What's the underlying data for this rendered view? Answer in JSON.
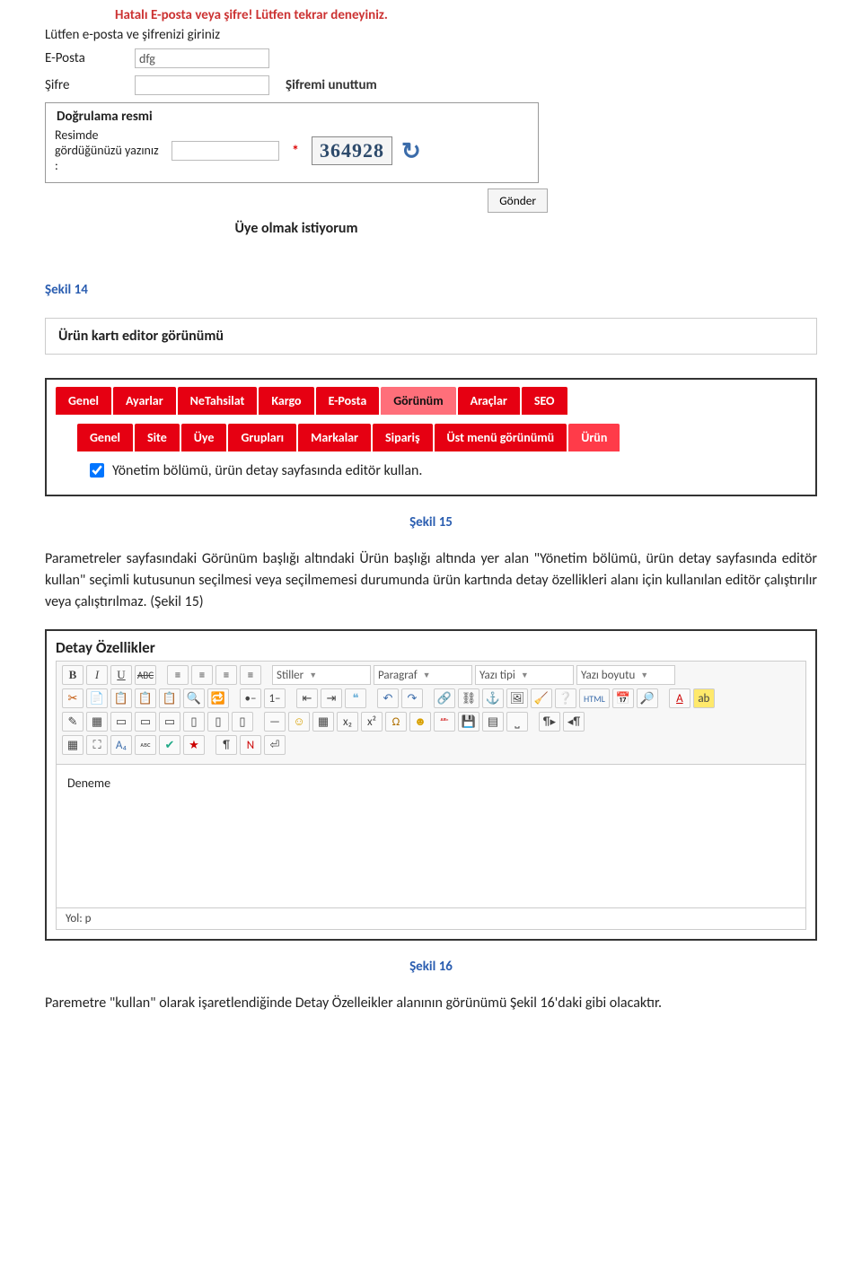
{
  "login": {
    "error": "Hatalı E-posta veya şifre! Lütfen tekrar deneyiniz.",
    "prompt": "Lütfen e-posta ve şifrenizi giriniz",
    "email_label": "E-Posta",
    "email_value": "dfg",
    "password_label": "Şifre",
    "forgot": "Şifremi unuttum",
    "captcha_legend": "Doğrulama resmi",
    "captcha_label": "Resimde gördüğünüzü yazınız :",
    "captcha_value": "364928",
    "submit": "Gönder",
    "signup": "Üye olmak istiyorum"
  },
  "captions": {
    "fig14": "Şekil 14",
    "fig15": "Şekil 15",
    "fig16": "Şekil 16"
  },
  "section_title": "Ürün kartı editor görünümü",
  "tabs": {
    "top": [
      "Genel",
      "Ayarlar",
      "NeTahsilat",
      "Kargo",
      "E-Posta",
      "Görünüm",
      "Araçlar",
      "SEO"
    ],
    "inner": [
      "Genel",
      "Site",
      "Üye",
      "Grupları",
      "Markalar",
      "Sipariş",
      "Üst menü görünümü",
      "Ürün"
    ],
    "checkbox_label": "Yönetim bölümü, ürün detay sayfasında editör kullan."
  },
  "paragraph1": "Parametreler sayfasındaki Görünüm başlığı altındaki Ürün başlığı altında yer alan \"Yönetim bölümü, ürün detay sayfasında editör kullan\" seçimli kutusunun seçilmesi veya seçilmemesi durumunda ürün kartında detay özellikleri alanı için kullanılan editör çalıştırılır veya çalıştırılmaz. (Şekil 15)",
  "editor": {
    "heading": "Detay Özellikler",
    "selects": {
      "style": "Stiller",
      "format": "Paragraf",
      "font": "Yazı tipi",
      "size": "Yazı boyutu"
    },
    "btns": {
      "bold": "B",
      "italic": "I",
      "underline": "U",
      "strike": "ABC",
      "alignL": "≡",
      "alignC": "≡",
      "alignR": "≡",
      "alignJ": "≡",
      "cut": "✂",
      "copy": "📄",
      "paste": "📋",
      "pasteT": "📋",
      "pasteW": "📋",
      "find": "🔍",
      "replace": "🔁",
      "ul": "•–",
      "ol": "1–",
      "outdent": "⇤",
      "indent": "⇥",
      "quote": "❝",
      "undo": "↶",
      "redo": "↷",
      "link": "🔗",
      "unlink": "⛓",
      "anchor": "⚓",
      "image": "🖼",
      "clean": "🧹",
      "help": "❔",
      "html": "HTML",
      "date": "📅",
      "preview": "🔎",
      "fcolor": "A",
      "bcolor": "ab",
      "edit": "✎",
      "table": "▦",
      "rowb": "▭",
      "rowa": "▭",
      "delr": "▭",
      "colb": "▯",
      "cola": "▯",
      "delc": "▯",
      "hr": "—",
      "smile": "☺",
      "media": "▦",
      "sub": "x₂",
      "sup": "x²",
      "omega": "Ω",
      "emote": "☻",
      "abc": "ᴬᴮᶜ",
      "save": "💾",
      "layer": "▤",
      "nbsp": "⎵",
      "ltr": "¶▸",
      "rtl": "◂¶",
      "layer2": "▦",
      "fs": "⛶",
      "aa": "A₄",
      "small": "ᴀʙᴄ",
      "spell": "✔",
      "star": "★",
      "pilcrow": "¶",
      "ns": "N",
      "brk": "⏎"
    },
    "content": "Deneme",
    "path": "Yol: p"
  },
  "paragraph2": "Paremetre \"kullan\" olarak işaretlendiğinde Detay Özelleikler alanının görünümü Şekil 16'daki gibi olacaktır."
}
